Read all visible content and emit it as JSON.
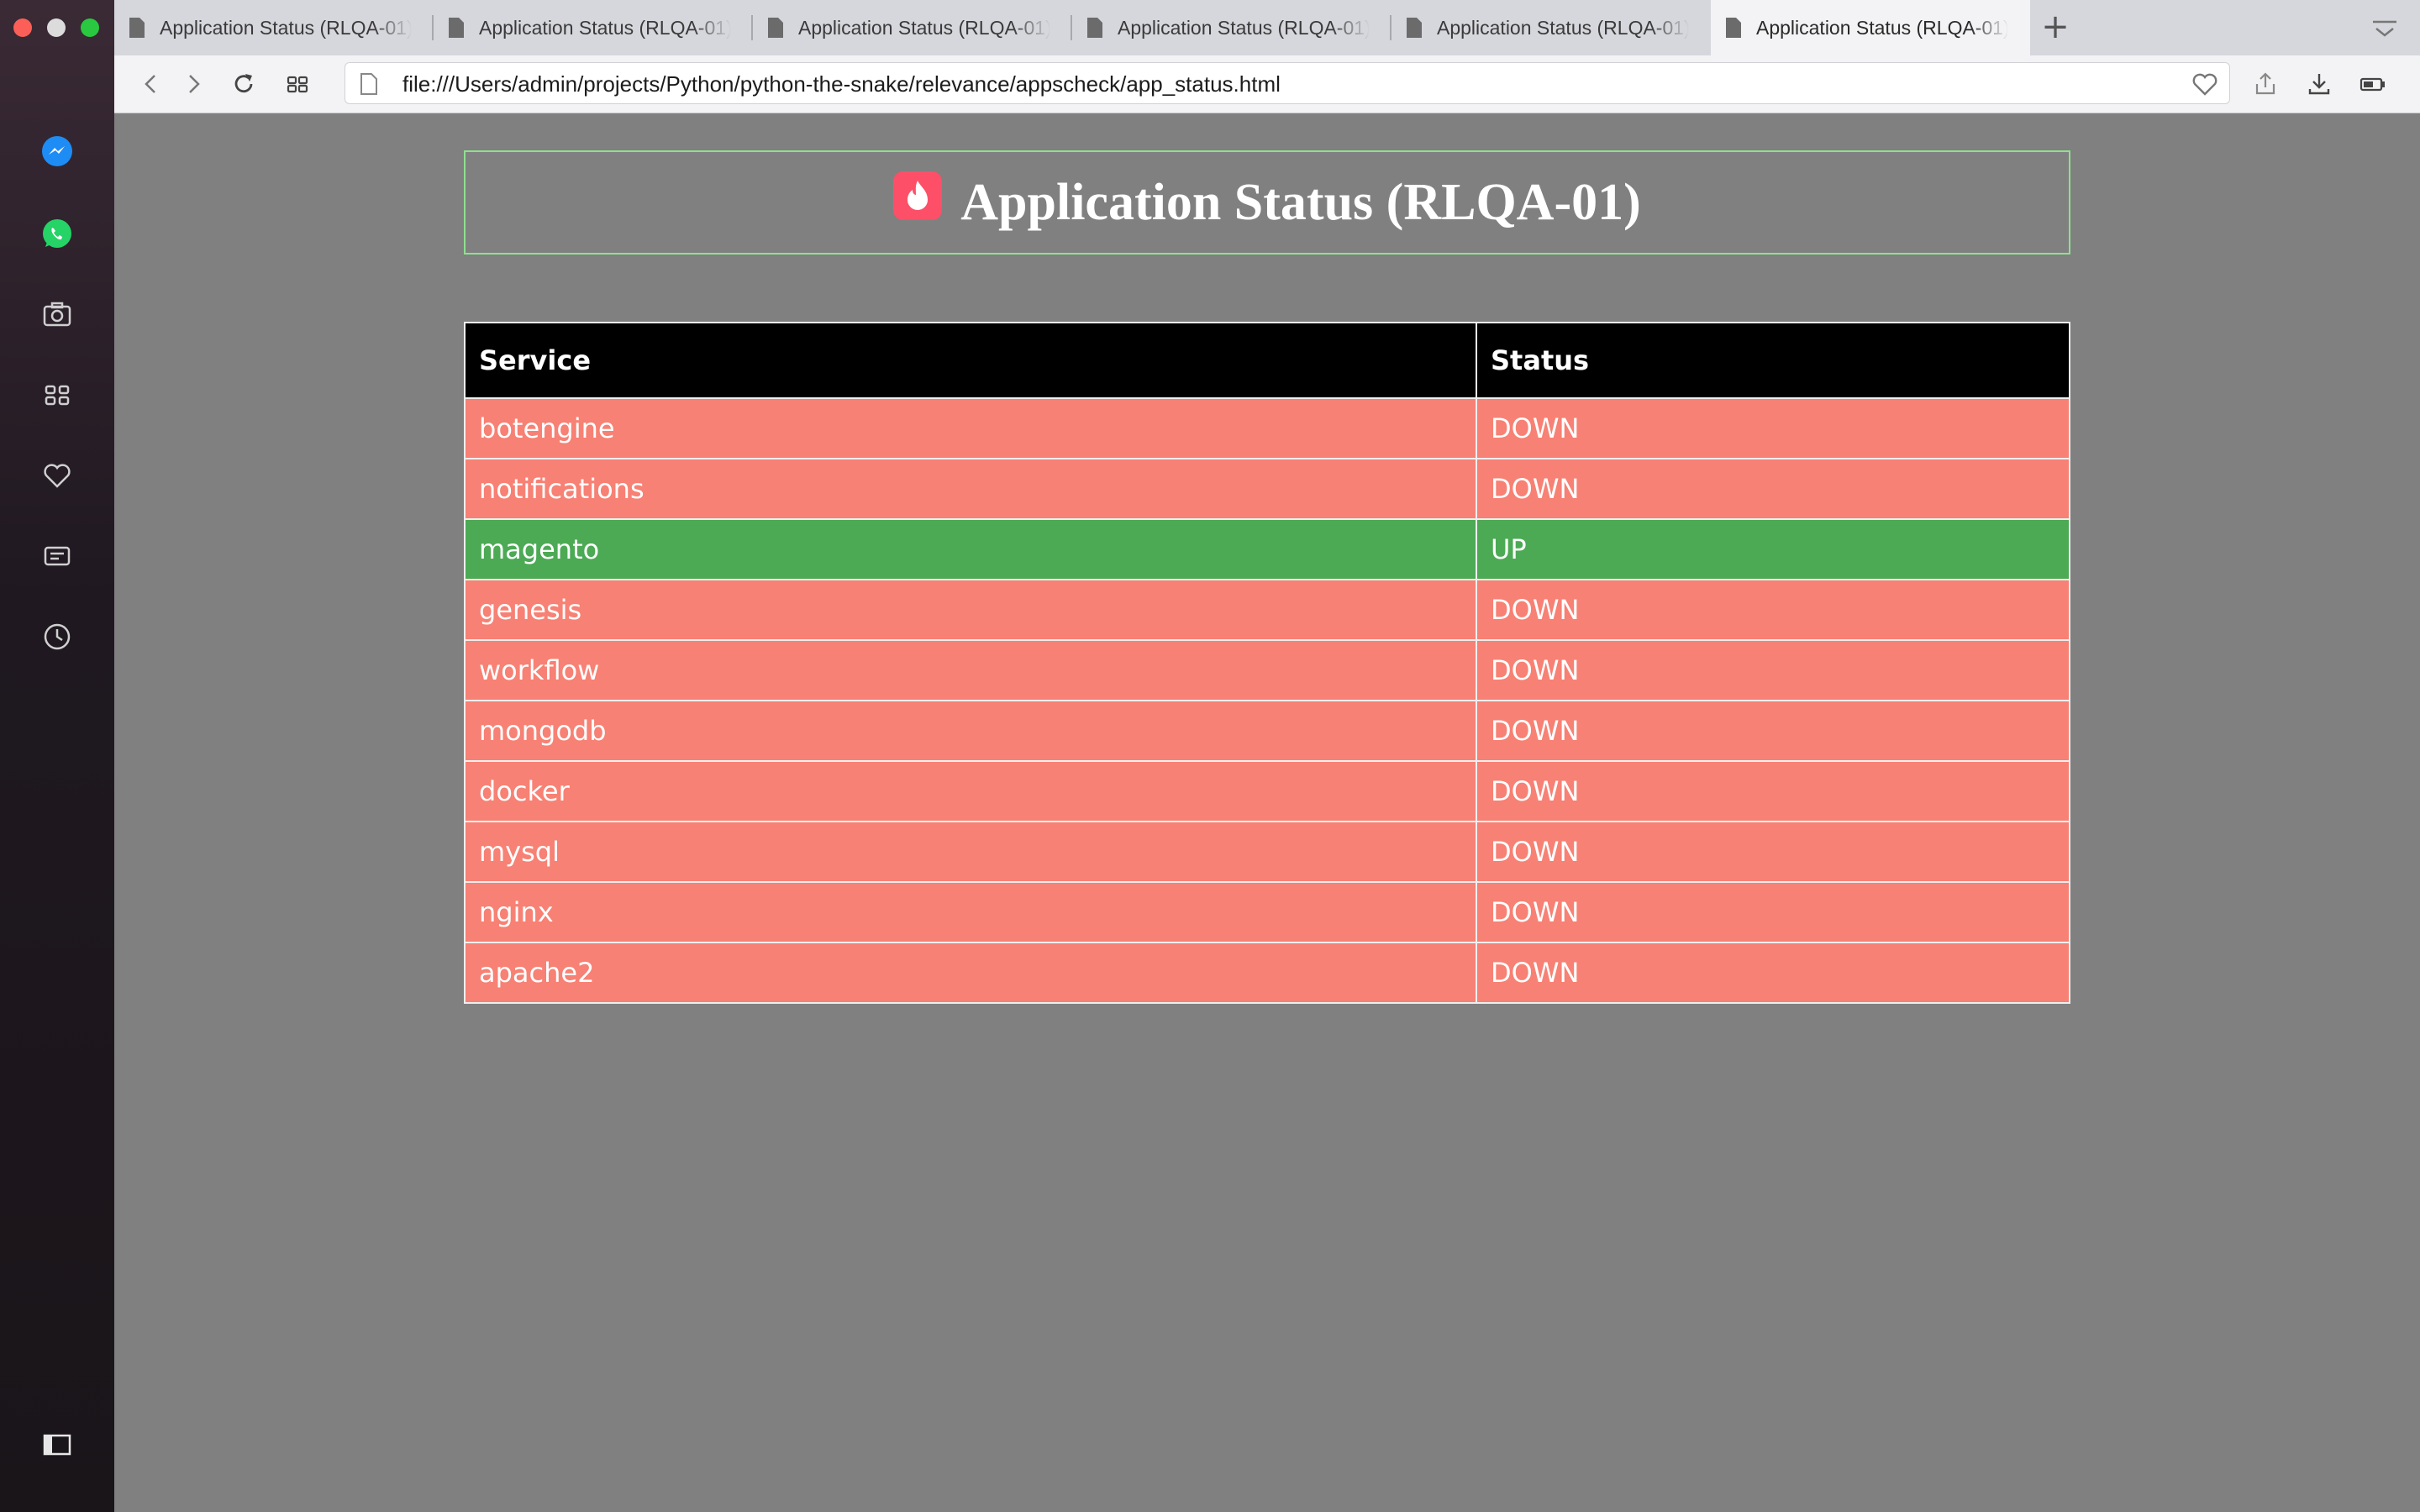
{
  "browser": {
    "tabs": [
      {
        "title": "Application Status (RLQA-01)",
        "active": false
      },
      {
        "title": "Application Status (RLQA-01)",
        "active": false
      },
      {
        "title": "Application Status (RLQA-01)",
        "active": false
      },
      {
        "title": "Application Status (RLQA-01)",
        "active": false
      },
      {
        "title": "Application Status (RLQA-01)",
        "active": false
      },
      {
        "title": "Application Status (RLQA-01)",
        "active": true
      }
    ],
    "url": "file:///Users/admin/projects/Python/python-the-snake/relevance/appscheck/app_status.html"
  },
  "sidebar": {
    "icons": [
      "messenger-icon",
      "whatsapp-icon",
      "camera-icon",
      "speed-dial-icon",
      "heart-icon",
      "news-icon",
      "history-icon",
      "sidebar-toggle-icon"
    ]
  },
  "page": {
    "title": "Application Status (RLQA-01)",
    "table": {
      "headers": [
        "Service",
        "Status"
      ],
      "rows": [
        {
          "service": "botengine",
          "status": "DOWN"
        },
        {
          "service": "notifications",
          "status": "DOWN"
        },
        {
          "service": "magento",
          "status": "UP"
        },
        {
          "service": "genesis",
          "status": "DOWN"
        },
        {
          "service": "workflow",
          "status": "DOWN"
        },
        {
          "service": "mongodb",
          "status": "DOWN"
        },
        {
          "service": "docker",
          "status": "DOWN"
        },
        {
          "service": "mysql",
          "status": "DOWN"
        },
        {
          "service": "nginx",
          "status": "DOWN"
        },
        {
          "service": "apache2",
          "status": "DOWN"
        }
      ]
    }
  },
  "colors": {
    "down": "#f78174",
    "up": "#4caa55",
    "header": "#000000",
    "page_bg": "#808080",
    "title_border": "#8fe08f"
  }
}
